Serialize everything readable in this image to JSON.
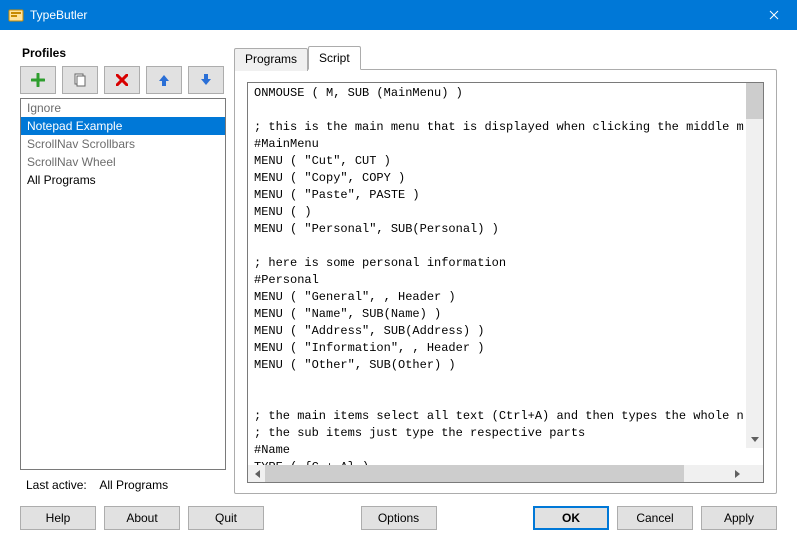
{
  "window": {
    "title": "TypeButler"
  },
  "profiles": {
    "heading": "Profiles",
    "items": [
      {
        "label": "Ignore",
        "dim": true,
        "sel": false
      },
      {
        "label": "Notepad Example",
        "dim": false,
        "sel": true
      },
      {
        "label": "ScrollNav Scrollbars",
        "dim": true,
        "sel": false
      },
      {
        "label": "ScrollNav Wheel",
        "dim": true,
        "sel": false
      },
      {
        "label": "All Programs",
        "dim": false,
        "sel": false
      }
    ],
    "last_active_label": "Last active:",
    "last_active_value": "All Programs"
  },
  "tabs": {
    "programs": "Programs",
    "script": "Script",
    "active": "script"
  },
  "script": "ONMOUSE ( M, SUB (MainMenu) )\n\n; this is the main menu that is displayed when clicking the middle m\n#MainMenu\nMENU ( \"Cut\", CUT )\nMENU ( \"Copy\", COPY )\nMENU ( \"Paste\", PASTE )\nMENU ( )\nMENU ( \"Personal\", SUB(Personal) )\n\n; here is some personal information\n#Personal\nMENU ( \"General\", , Header )\nMENU ( \"Name\", SUB(Name) )\nMENU ( \"Address\", SUB(Address) )\nMENU ( \"Information\", , Header )\nMENU ( \"Other\", SUB(Other) )\n\n\n; the main items select all text (Ctrl+A) and then types the whole n\n; the sub items just type the respective parts\n#Name\nTYPE ( {C + A} )\nTYPE ( \"Test User\" )\nMENU ( \"First\", TYPE(\"Test\") )",
  "buttons": {
    "help": "Help",
    "about": "About",
    "quit": "Quit",
    "options": "Options",
    "ok": "OK",
    "cancel": "Cancel",
    "apply": "Apply"
  }
}
